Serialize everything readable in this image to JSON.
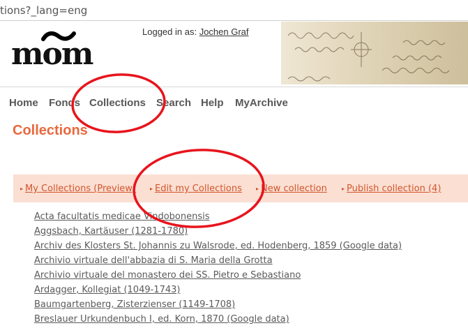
{
  "browser": {
    "url_fragment": "tions?_lang=eng"
  },
  "header": {
    "logo_text": "mom",
    "login_prefix": "Logged in as:",
    "user_name": "Jochen Graf"
  },
  "nav": {
    "items": [
      {
        "label": "Home"
      },
      {
        "label": "Fonds"
      },
      {
        "label": "Collections"
      },
      {
        "label": "Search"
      },
      {
        "label": "Help"
      },
      {
        "label": "MyArchive"
      }
    ]
  },
  "main": {
    "title": "Collections",
    "tabs": [
      {
        "label": "My Collections (Preview)"
      },
      {
        "label": "Edit my Collections"
      },
      {
        "label": "New collection"
      },
      {
        "label": "Publish collection (4)"
      }
    ],
    "collections": [
      "Acta facultatis medicae Vindobonensis",
      "Aggsbach, Kartäuser (1281-1780)",
      "Archiv des Klosters St. Johannis zu Walsrode, ed. Hodenberg, 1859 (Google data)",
      "Archivio virtuale dell'abbazia di S. Maria della Grotta",
      "Archivio virtuale del monastero dei SS. Pietro e Sebastiano",
      "Ardagger, Kollegiat (1049-1743)",
      "Baumgartenberg, Zisterzienser (1149-1708)",
      "Breslauer Urkundenbuch I, ed. Korn, 1870 (Google data)"
    ]
  },
  "colors": {
    "accent": "#e8693e",
    "tab_bg": "#fbdfd3",
    "tab_link": "#d2552c",
    "annotation_circle": "#e8141c"
  }
}
